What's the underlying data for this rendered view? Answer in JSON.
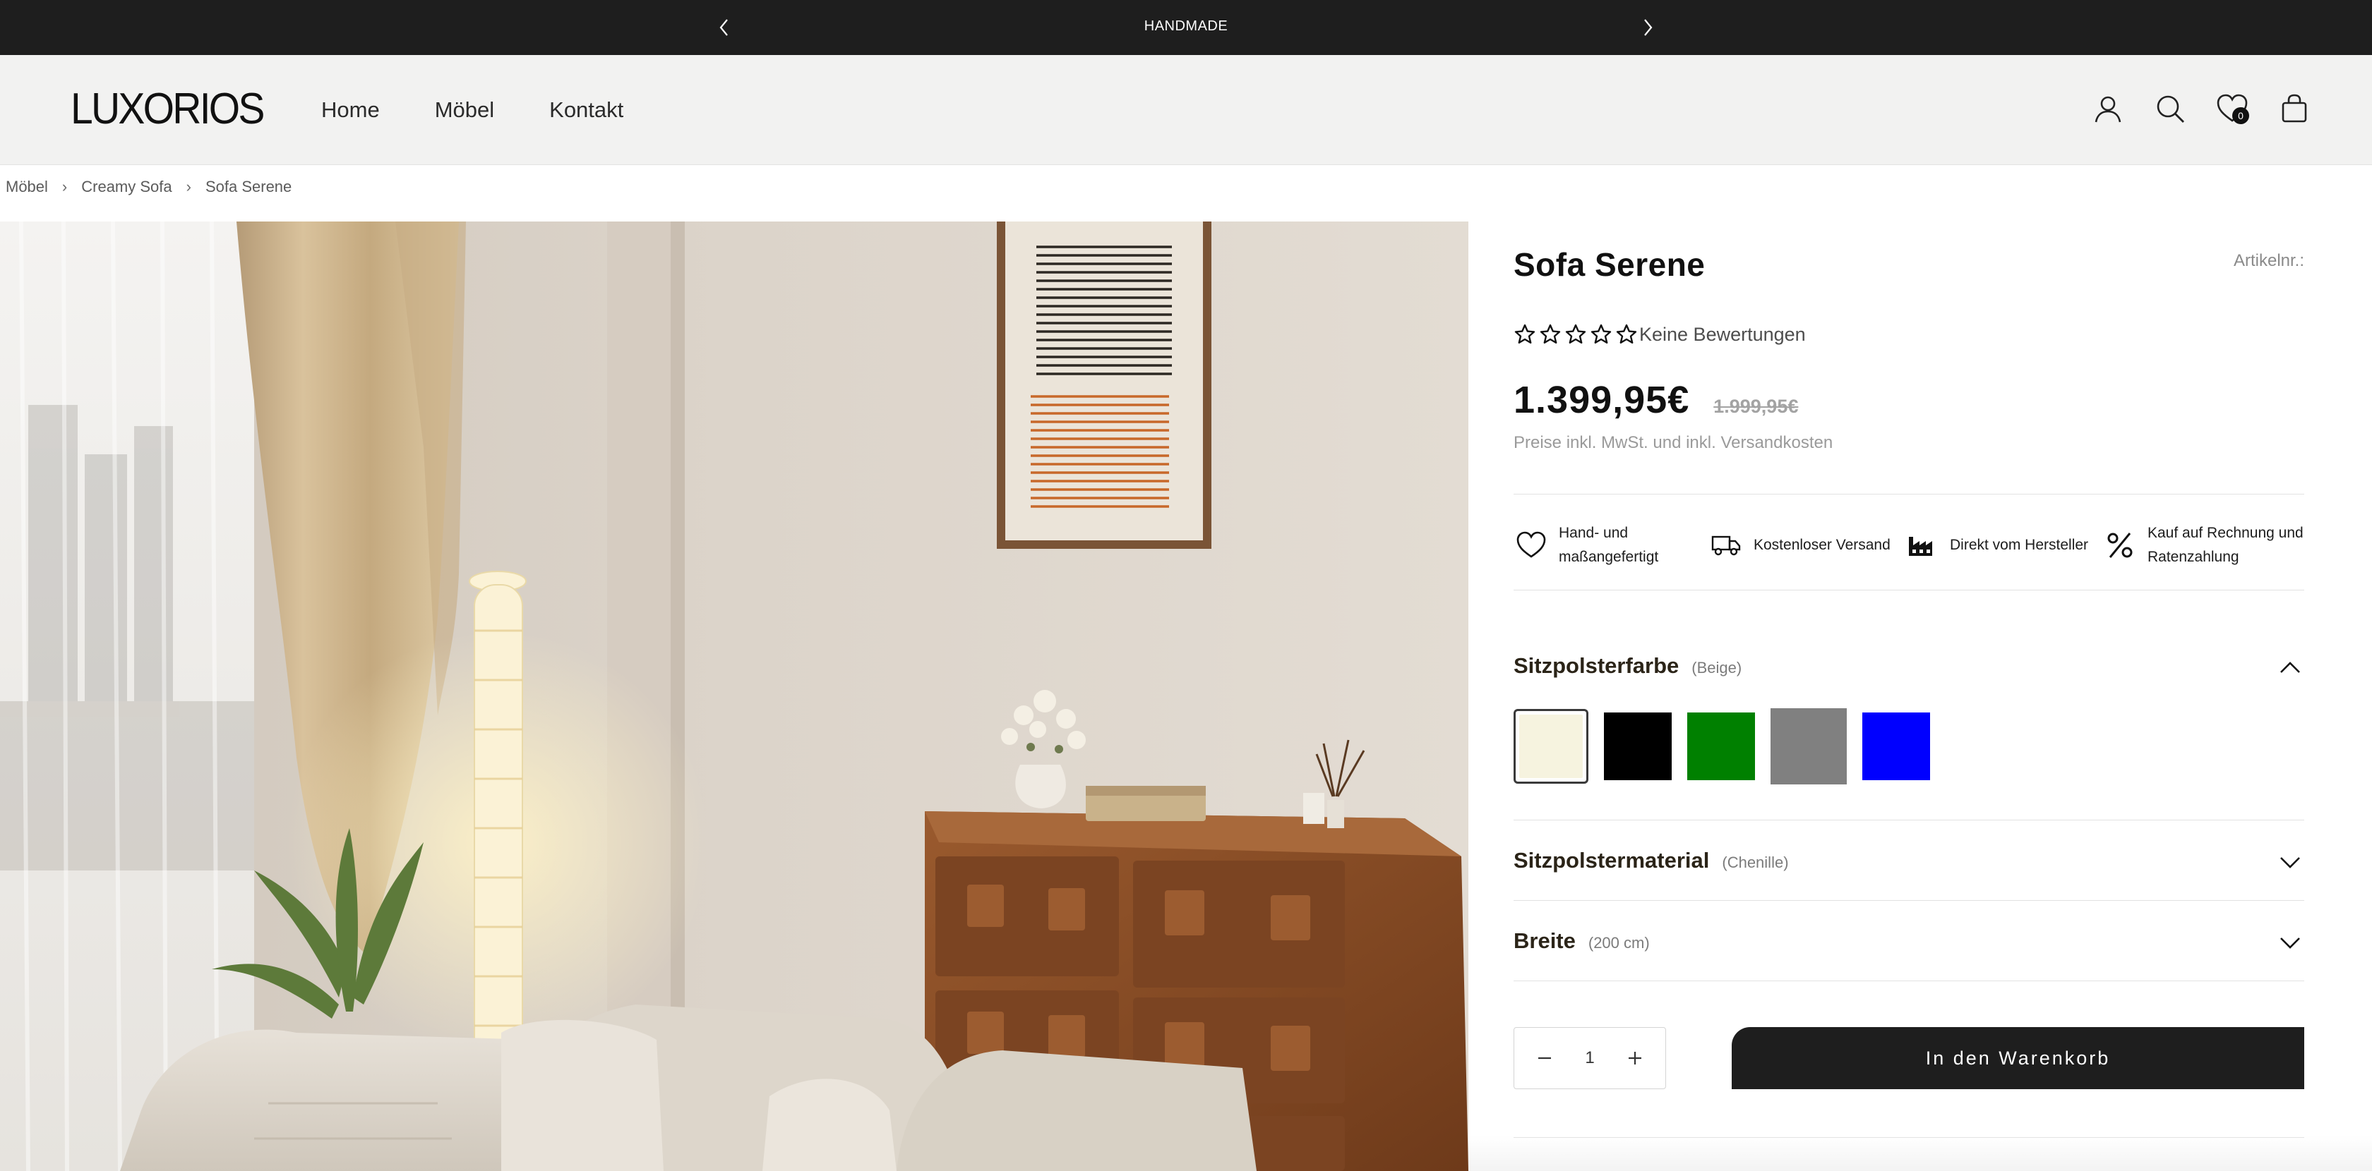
{
  "announcement": {
    "text": "HANDMADE"
  },
  "header": {
    "logo": "LUXORIOS",
    "nav": [
      "Home",
      "Möbel",
      "Kontakt"
    ],
    "wishlist_count": "0"
  },
  "breadcrumb": [
    "Möbel",
    "Creamy Sofa",
    "Sofa Serene"
  ],
  "product": {
    "title": "Sofa Serene",
    "sku_label": "Artikelnr.:",
    "rating_label": "Keine Bewertungen",
    "rating_value": 0,
    "rating_max": 5,
    "price": "1.399,95€",
    "old_price": "1.999,95€",
    "price_note": "Preise inkl. MwSt. und inkl. Versandkosten",
    "features": [
      {
        "icon": "heart-icon",
        "text": "Hand- und maßangefertigt"
      },
      {
        "icon": "truck-icon",
        "text": "Kostenloser Versand"
      },
      {
        "icon": "factory-icon",
        "text": "Direkt vom Hersteller"
      },
      {
        "icon": "percent-icon",
        "text": "Kauf auf Rechnung und Ratenzahlung"
      }
    ],
    "options": [
      {
        "name": "Sitzpolsterfarbe",
        "value": "(Beige)",
        "expanded": true
      },
      {
        "name": "Sitzpolstermaterial",
        "value": "(Chenille)",
        "expanded": false
      },
      {
        "name": "Breite",
        "value": "(200 cm)",
        "expanded": false
      }
    ],
    "swatches": [
      {
        "name": "beige",
        "color": "#f6f3df",
        "selected": true
      },
      {
        "name": "black",
        "color": "#000000",
        "selected": false
      },
      {
        "name": "green",
        "color": "#008000",
        "selected": false
      },
      {
        "name": "gray",
        "color": "#808080",
        "selected": false
      },
      {
        "name": "blue",
        "color": "#0000ff",
        "selected": false
      }
    ],
    "quantity": "1",
    "add_to_cart": "In den Warenkorb"
  }
}
